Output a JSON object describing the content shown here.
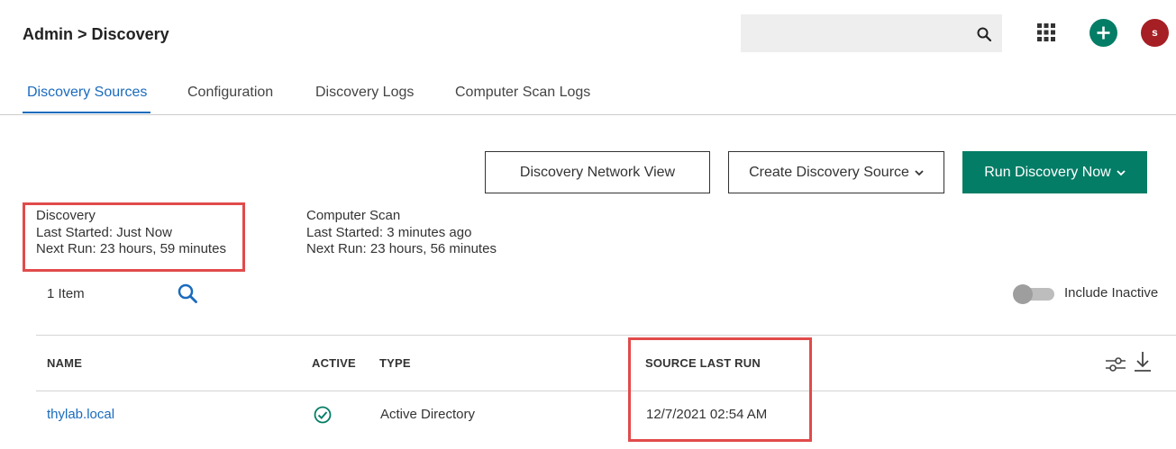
{
  "header": {
    "breadcrumb_root": "Admin",
    "breadcrumb_separator": ">",
    "breadcrumb_current": "Discovery",
    "search_placeholder": "",
    "avatar_initial": "s",
    "colors": {
      "accent": "#047d66",
      "avatar": "#a51f24",
      "link": "#1a6bbd"
    }
  },
  "tabs": [
    {
      "label": "Discovery Sources",
      "active": true
    },
    {
      "label": "Configuration",
      "active": false
    },
    {
      "label": "Discovery Logs",
      "active": false
    },
    {
      "label": "Computer Scan Logs",
      "active": false
    }
  ],
  "actions": {
    "network_view": "Discovery Network View",
    "create_source": "Create Discovery Source",
    "run_now": "Run Discovery Now"
  },
  "status": {
    "discovery": {
      "title": "Discovery",
      "last_started": "Last Started: Just Now",
      "next_run": "Next Run: 23 hours, 59 minutes"
    },
    "computer_scan": {
      "title": "Computer Scan",
      "last_started": "Last Started: 3 minutes ago",
      "next_run": "Next Run: 23 hours, 56 minutes"
    }
  },
  "list": {
    "item_count": "1 Item",
    "include_inactive_label": "Include Inactive",
    "include_inactive": false
  },
  "table": {
    "columns": [
      "NAME",
      "ACTIVE",
      "TYPE",
      "SOURCE LAST RUN"
    ],
    "rows": [
      {
        "name": "thylab.local",
        "active": true,
        "type": "Active Directory",
        "source_last_run": "12/7/2021 02:54 AM"
      }
    ]
  },
  "icons": {
    "search": "search-icon",
    "apps": "apps-grid-icon",
    "add": "plus-icon",
    "list_search": "search-icon",
    "column_filter": "sliders-icon",
    "download": "download-icon",
    "active_check": "check-circle-icon"
  }
}
